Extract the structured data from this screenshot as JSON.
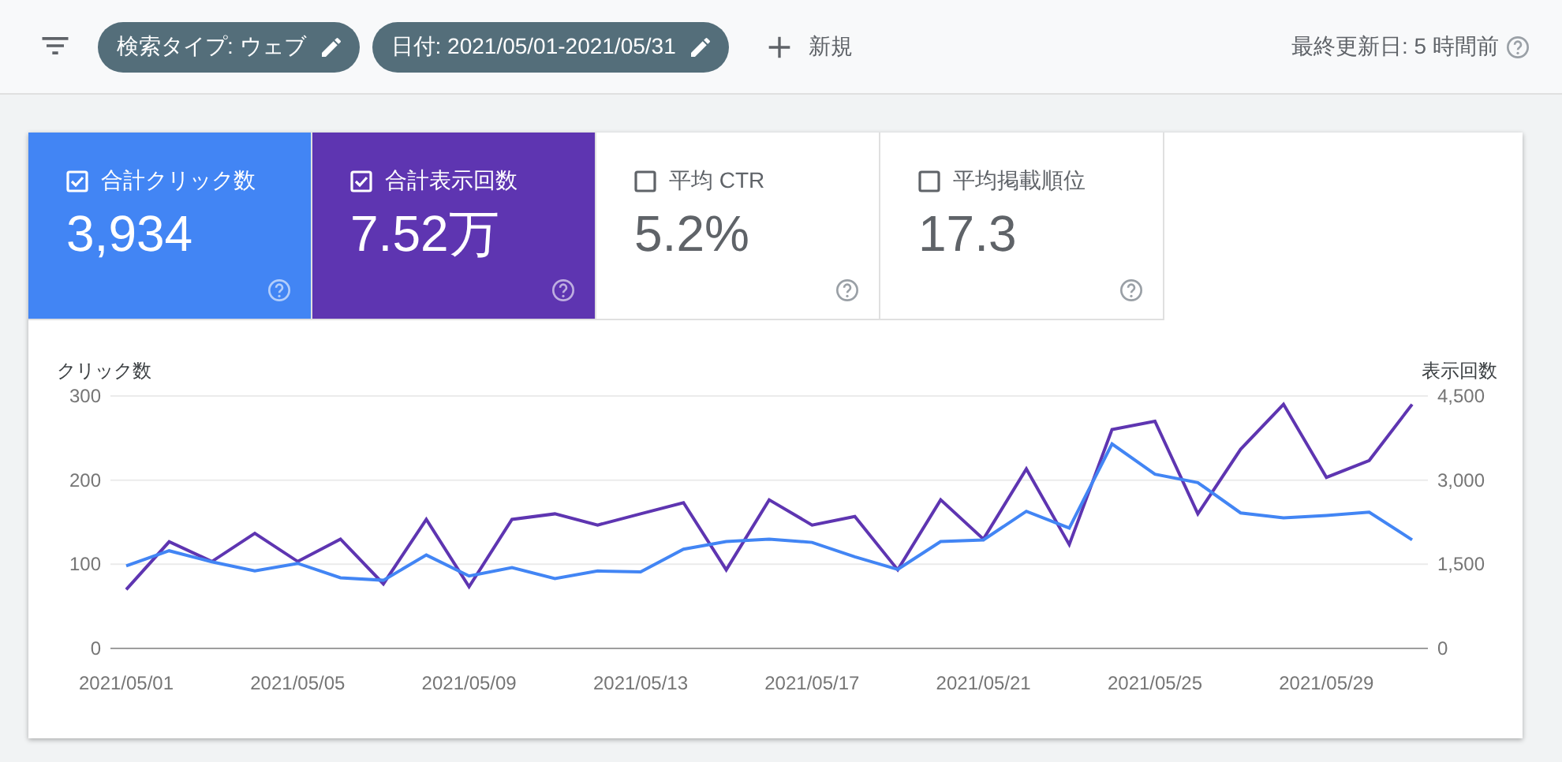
{
  "toolbar": {
    "chips": [
      {
        "label": "検索タイプ: ウェブ"
      },
      {
        "label": "日付: 2021/05/01-2021/05/31"
      }
    ],
    "new_button": "新規",
    "last_updated": "最終更新日: 5 時間前"
  },
  "metrics": [
    {
      "label": "合計クリック数",
      "value": "3,934",
      "checked": true,
      "color": "#4285f4"
    },
    {
      "label": "合計表示回数",
      "value": "7.52万",
      "checked": true,
      "color": "#5e35b1"
    },
    {
      "label": "平均 CTR",
      "value": "5.2%",
      "checked": false
    },
    {
      "label": "平均掲載順位",
      "value": "17.3",
      "checked": false
    }
  ],
  "chart": {
    "chart_data": {
      "type": "line",
      "ylabel": "クリック数",
      "y2label": "表示回数",
      "categories": [
        "2021/05/01",
        null,
        null,
        null,
        "2021/05/05",
        null,
        null,
        null,
        "2021/05/09",
        null,
        null,
        null,
        "2021/05/13",
        null,
        null,
        null,
        "2021/05/17",
        null,
        null,
        null,
        "2021/05/21",
        null,
        null,
        null,
        "2021/05/25",
        null,
        null,
        null,
        "2021/05/29",
        null,
        null
      ],
      "ylim": [
        0,
        300
      ],
      "yticks": [
        0,
        100,
        200,
        300
      ],
      "y2lim": [
        0,
        4500
      ],
      "y2ticks": [
        {
          "value": 0,
          "label": "0"
        },
        {
          "value": 1500,
          "label": "1,500"
        },
        {
          "value": 3000,
          "label": "3,000"
        },
        {
          "value": 4500,
          "label": "4,500"
        }
      ],
      "series": [
        {
          "color": "#4285f4",
          "values": [
            98,
            116,
            103,
            92,
            101,
            84,
            81,
            111,
            86,
            96,
            83,
            92,
            91,
            118,
            127,
            130,
            126,
            109,
            94,
            127,
            129,
            163,
            143,
            243,
            207,
            197,
            161,
            155,
            158,
            162,
            129
          ]
        },
        {
          "color": "#5e35b1",
          "axis": "y2",
          "values": [
            1050,
            1900,
            1550,
            2050,
            1550,
            1950,
            1150,
            2300,
            1100,
            2300,
            2400,
            2200,
            2400,
            2600,
            1400,
            2650,
            2200,
            2350,
            1400,
            2650,
            1950,
            3200,
            1850,
            3900,
            4050,
            2400,
            3550,
            4350,
            3050,
            3350,
            4350
          ]
        }
      ]
    }
  }
}
